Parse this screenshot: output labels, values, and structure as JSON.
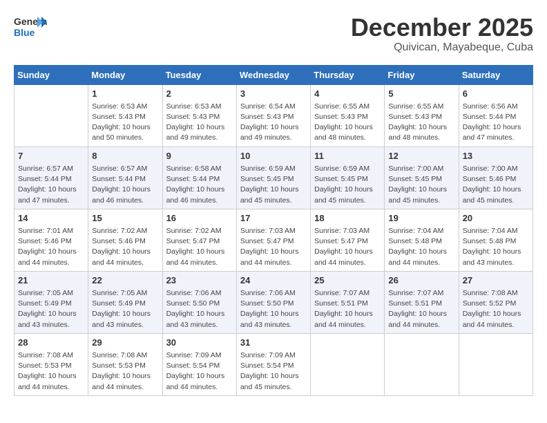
{
  "header": {
    "logo_general": "General",
    "logo_blue": "Blue",
    "month": "December 2025",
    "location": "Quivican, Mayabeque, Cuba"
  },
  "days_of_week": [
    "Sunday",
    "Monday",
    "Tuesday",
    "Wednesday",
    "Thursday",
    "Friday",
    "Saturday"
  ],
  "weeks": [
    [
      {
        "day": "",
        "info": ""
      },
      {
        "day": "1",
        "info": "Sunrise: 6:53 AM\nSunset: 5:43 PM\nDaylight: 10 hours\nand 50 minutes."
      },
      {
        "day": "2",
        "info": "Sunrise: 6:53 AM\nSunset: 5:43 PM\nDaylight: 10 hours\nand 49 minutes."
      },
      {
        "day": "3",
        "info": "Sunrise: 6:54 AM\nSunset: 5:43 PM\nDaylight: 10 hours\nand 49 minutes."
      },
      {
        "day": "4",
        "info": "Sunrise: 6:55 AM\nSunset: 5:43 PM\nDaylight: 10 hours\nand 48 minutes."
      },
      {
        "day": "5",
        "info": "Sunrise: 6:55 AM\nSunset: 5:43 PM\nDaylight: 10 hours\nand 48 minutes."
      },
      {
        "day": "6",
        "info": "Sunrise: 6:56 AM\nSunset: 5:44 PM\nDaylight: 10 hours\nand 47 minutes."
      }
    ],
    [
      {
        "day": "7",
        "info": "Sunrise: 6:57 AM\nSunset: 5:44 PM\nDaylight: 10 hours\nand 47 minutes."
      },
      {
        "day": "8",
        "info": "Sunrise: 6:57 AM\nSunset: 5:44 PM\nDaylight: 10 hours\nand 46 minutes."
      },
      {
        "day": "9",
        "info": "Sunrise: 6:58 AM\nSunset: 5:44 PM\nDaylight: 10 hours\nand 46 minutes."
      },
      {
        "day": "10",
        "info": "Sunrise: 6:59 AM\nSunset: 5:45 PM\nDaylight: 10 hours\nand 45 minutes."
      },
      {
        "day": "11",
        "info": "Sunrise: 6:59 AM\nSunset: 5:45 PM\nDaylight: 10 hours\nand 45 minutes."
      },
      {
        "day": "12",
        "info": "Sunrise: 7:00 AM\nSunset: 5:45 PM\nDaylight: 10 hours\nand 45 minutes."
      },
      {
        "day": "13",
        "info": "Sunrise: 7:00 AM\nSunset: 5:46 PM\nDaylight: 10 hours\nand 45 minutes."
      }
    ],
    [
      {
        "day": "14",
        "info": "Sunrise: 7:01 AM\nSunset: 5:46 PM\nDaylight: 10 hours\nand 44 minutes."
      },
      {
        "day": "15",
        "info": "Sunrise: 7:02 AM\nSunset: 5:46 PM\nDaylight: 10 hours\nand 44 minutes."
      },
      {
        "day": "16",
        "info": "Sunrise: 7:02 AM\nSunset: 5:47 PM\nDaylight: 10 hours\nand 44 minutes."
      },
      {
        "day": "17",
        "info": "Sunrise: 7:03 AM\nSunset: 5:47 PM\nDaylight: 10 hours\nand 44 minutes."
      },
      {
        "day": "18",
        "info": "Sunrise: 7:03 AM\nSunset: 5:47 PM\nDaylight: 10 hours\nand 44 minutes."
      },
      {
        "day": "19",
        "info": "Sunrise: 7:04 AM\nSunset: 5:48 PM\nDaylight: 10 hours\nand 44 minutes."
      },
      {
        "day": "20",
        "info": "Sunrise: 7:04 AM\nSunset: 5:48 PM\nDaylight: 10 hours\nand 43 minutes."
      }
    ],
    [
      {
        "day": "21",
        "info": "Sunrise: 7:05 AM\nSunset: 5:49 PM\nDaylight: 10 hours\nand 43 minutes."
      },
      {
        "day": "22",
        "info": "Sunrise: 7:05 AM\nSunset: 5:49 PM\nDaylight: 10 hours\nand 43 minutes."
      },
      {
        "day": "23",
        "info": "Sunrise: 7:06 AM\nSunset: 5:50 PM\nDaylight: 10 hours\nand 43 minutes."
      },
      {
        "day": "24",
        "info": "Sunrise: 7:06 AM\nSunset: 5:50 PM\nDaylight: 10 hours\nand 43 minutes."
      },
      {
        "day": "25",
        "info": "Sunrise: 7:07 AM\nSunset: 5:51 PM\nDaylight: 10 hours\nand 44 minutes."
      },
      {
        "day": "26",
        "info": "Sunrise: 7:07 AM\nSunset: 5:51 PM\nDaylight: 10 hours\nand 44 minutes."
      },
      {
        "day": "27",
        "info": "Sunrise: 7:08 AM\nSunset: 5:52 PM\nDaylight: 10 hours\nand 44 minutes."
      }
    ],
    [
      {
        "day": "28",
        "info": "Sunrise: 7:08 AM\nSunset: 5:53 PM\nDaylight: 10 hours\nand 44 minutes."
      },
      {
        "day": "29",
        "info": "Sunrise: 7:08 AM\nSunset: 5:53 PM\nDaylight: 10 hours\nand 44 minutes."
      },
      {
        "day": "30",
        "info": "Sunrise: 7:09 AM\nSunset: 5:54 PM\nDaylight: 10 hours\nand 44 minutes."
      },
      {
        "day": "31",
        "info": "Sunrise: 7:09 AM\nSunset: 5:54 PM\nDaylight: 10 hours\nand 45 minutes."
      },
      {
        "day": "",
        "info": ""
      },
      {
        "day": "",
        "info": ""
      },
      {
        "day": "",
        "info": ""
      }
    ]
  ]
}
